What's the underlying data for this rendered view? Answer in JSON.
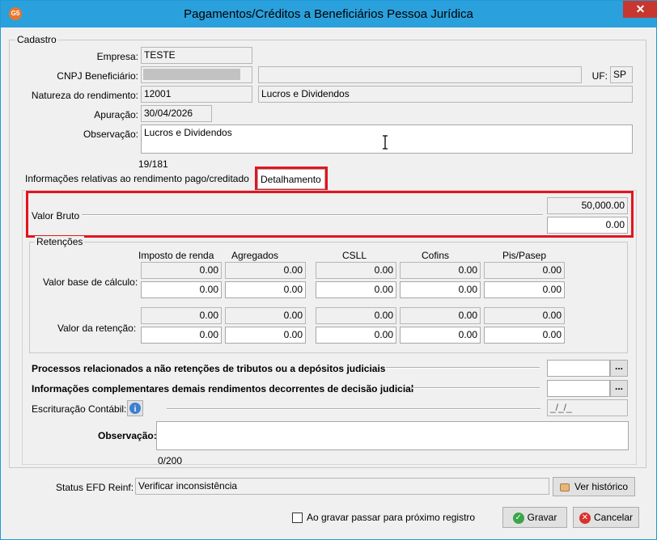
{
  "window": {
    "title": "Pagamentos/Créditos a Beneficiários Pessoa Jurídica",
    "close": "✕",
    "app_icon": "G5"
  },
  "cadastro": {
    "group_label": "Cadastro",
    "empresa_label": "Empresa:",
    "empresa_value": "TESTE",
    "cnpj_label": "CNPJ Beneficiário:",
    "cnpj_value": "",
    "beneficiario_name": "",
    "uf_label": "UF:",
    "uf_value": "SP",
    "natureza_label": "Natureza do rendimento:",
    "natureza_code": "12001",
    "natureza_desc": "Lucros e Dividendos",
    "apuracao_label": "Apuração:",
    "apuracao_value": "30/04/2026",
    "observacao_label": "Observação:",
    "observacao_value": "Lucros e Dividendos",
    "observacao_counter": "19/181"
  },
  "tabs": [
    {
      "label": "Informações relativas ao rendimento pago/creditado"
    },
    {
      "label": "Detalhamento"
    }
  ],
  "valor_bruto": {
    "label": "Valor Bruto",
    "value_top": "50,000.00",
    "value_bottom": "0.00"
  },
  "retencoes": {
    "group_label": "Retenções",
    "columns": [
      "Imposto de renda",
      "Agregados",
      "CSLL",
      "Cofins",
      "Pis/Pasep"
    ],
    "base_label": "Valor base de cálculo:",
    "retencao_label": "Valor da retenção:",
    "cell_value": "0.00"
  },
  "processos": {
    "label": "Processos relacionados a não retenções de tributos ou a depósitos judiciais",
    "button": "..."
  },
  "informacoes": {
    "label": "Informações complementares demais rendimentos decorrentes de decisão judicial",
    "button": "..."
  },
  "escrituracao": {
    "label": "Escrituração Contábil:",
    "date_placeholder": "_/_/_"
  },
  "observacao2": {
    "label": "Observação:",
    "counter": "0/200"
  },
  "status": {
    "label": "Status EFD Reinf:",
    "value": "Verificar inconsistência",
    "historico_button": "Ver histórico"
  },
  "footer": {
    "checkbox_label": "Ao gravar passar para próximo registro",
    "gravar": "Gravar",
    "cancelar": "Cancelar"
  },
  "colors": {
    "titlebar": "#2aa0dc",
    "highlight": "#e4141e",
    "close": "#c7372f"
  }
}
